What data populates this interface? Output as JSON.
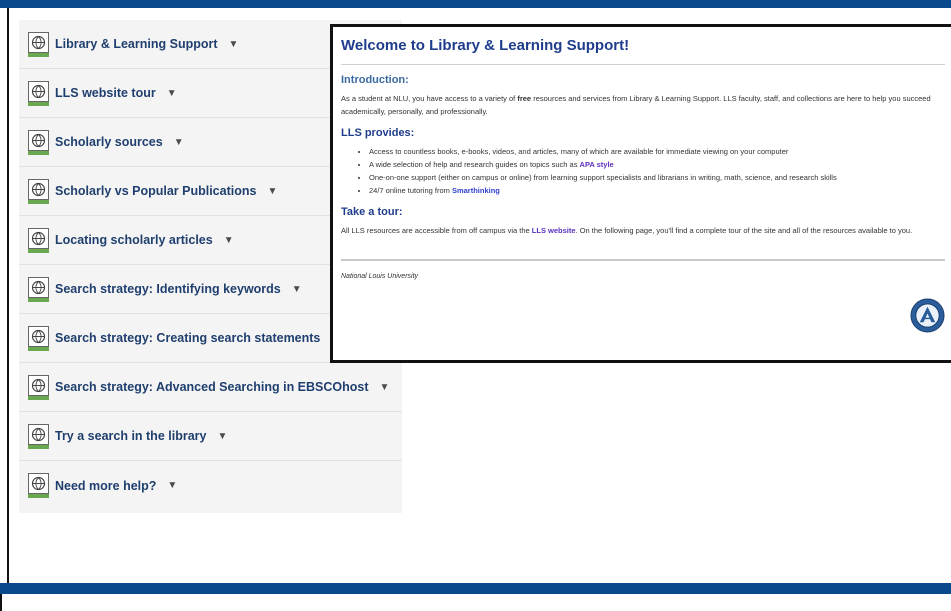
{
  "sidebar": {
    "items": [
      {
        "label": "Library & Learning Support"
      },
      {
        "label": "LLS website tour"
      },
      {
        "label": "Scholarly sources"
      },
      {
        "label": "Scholarly vs Popular Publications"
      },
      {
        "label": "Locating scholarly articles"
      },
      {
        "label": "Search strategy: Identifying keywords"
      },
      {
        "label": "Search strategy: Creating search statements"
      },
      {
        "label": "Search strategy: Advanced Searching in EBSCOhost"
      },
      {
        "label": "Try a search in the library"
      },
      {
        "label": "Need more help?"
      }
    ]
  },
  "panel": {
    "title": "Welcome to Library & Learning Support!",
    "intro": {
      "heading": "Introduction:",
      "text_before": "As a student at NLU, you have access to a variety of ",
      "text_bold": "free",
      "text_after": " resources and services from Library & Learning Support. LLS faculty, staff, and collections are here to help you succeed academically, personally, and professionally."
    },
    "provides": {
      "heading": "LLS provides:",
      "items": [
        {
          "text": "Access to countless books, e-books, videos, and articles, many of which are available for immediate viewing on your computer"
        },
        {
          "text": "A wide selection of help and research guides on topics such as ",
          "link": "APA style"
        },
        {
          "text": "One-on-one support (either on campus or online) from learning support specialists and librarians in writing, math, science, and research skills"
        },
        {
          "text": "24/7 online tutoring from ",
          "link": "Smarthinking"
        }
      ]
    },
    "tour": {
      "heading": "Take a tour:",
      "text_before": "All LLS resources are accessible from off campus via the ",
      "link": "LLS website",
      "text_after": ". On the following page, you'll find a complete tour of the site and all of the resources available to you."
    },
    "footer": "National Louis University"
  },
  "colors": {
    "brand_blue": "#0a4a8c",
    "nav_text": "#1f3f6e",
    "title_blue": "#1f3d8c",
    "link_purple": "#5a2fc0"
  },
  "icons": {
    "nav": "globe-page-icon",
    "caret": "caret-down-icon",
    "seal": "university-seal-icon"
  }
}
